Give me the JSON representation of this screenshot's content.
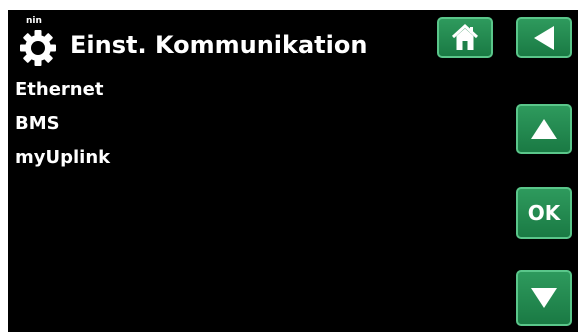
{
  "header": {
    "title": "Einst. Kommunikation",
    "icon": "gear-icon",
    "icon_label": "nin"
  },
  "menu": {
    "items": [
      {
        "label": "Ethernet"
      },
      {
        "label": "BMS"
      },
      {
        "label": "myUplink"
      }
    ]
  },
  "nav": {
    "home_icon": "home-icon",
    "back_icon": "arrow-left-icon",
    "up_icon": "arrow-up-icon",
    "ok_label": "OK",
    "down_icon": "arrow-down-icon"
  },
  "colors": {
    "background": "#000000",
    "text": "#ffffff",
    "button": "#1a7a44",
    "button_border": "#5ac68a"
  }
}
